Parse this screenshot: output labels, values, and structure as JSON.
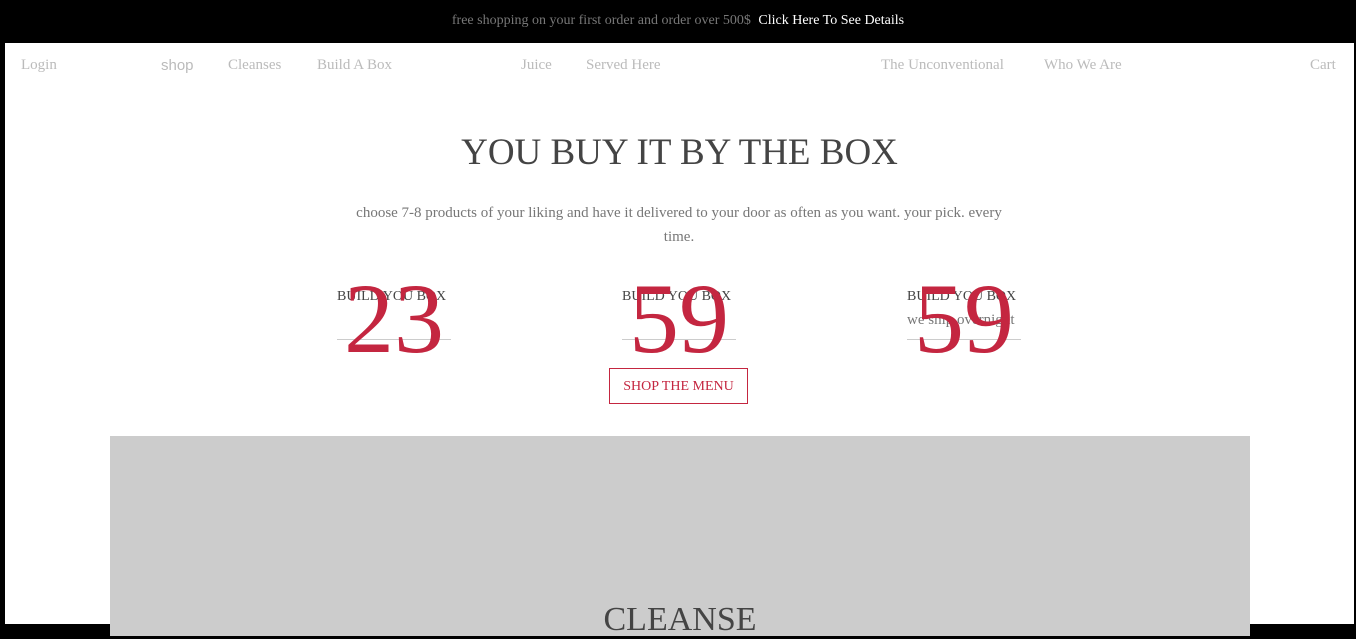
{
  "announcement": {
    "text": "free shopping on your first order and order over 500$",
    "link": "Click Here To See Details"
  },
  "nav": {
    "login": "Login",
    "shop": "shop",
    "cleanses": "Cleanses",
    "build_a_box": "Build A Box",
    "juice": "Juice",
    "served_here": "Served Here",
    "unconventional": "The Unconventional",
    "who_we_are": "Who We Are",
    "cart": "Cart"
  },
  "main": {
    "title": "YOU BUY IT BY THE BOX",
    "subtitle": "choose 7-8 products of your liking and have it delivered to your door as often as you want. your pick. every time.",
    "stats": [
      {
        "number": "23",
        "label": "BUILD YOU BOX"
      },
      {
        "number": "59",
        "label": "BUILD YOU BOX"
      },
      {
        "number": "59",
        "label": "BUILD YOU BOX",
        "note": "we ship overnight"
      }
    ],
    "cta": "SHOP THE MENU"
  },
  "hero": {
    "title": "CLEANSE"
  },
  "colors": {
    "accent": "#c42640",
    "hero_bg": "#cccccc"
  }
}
